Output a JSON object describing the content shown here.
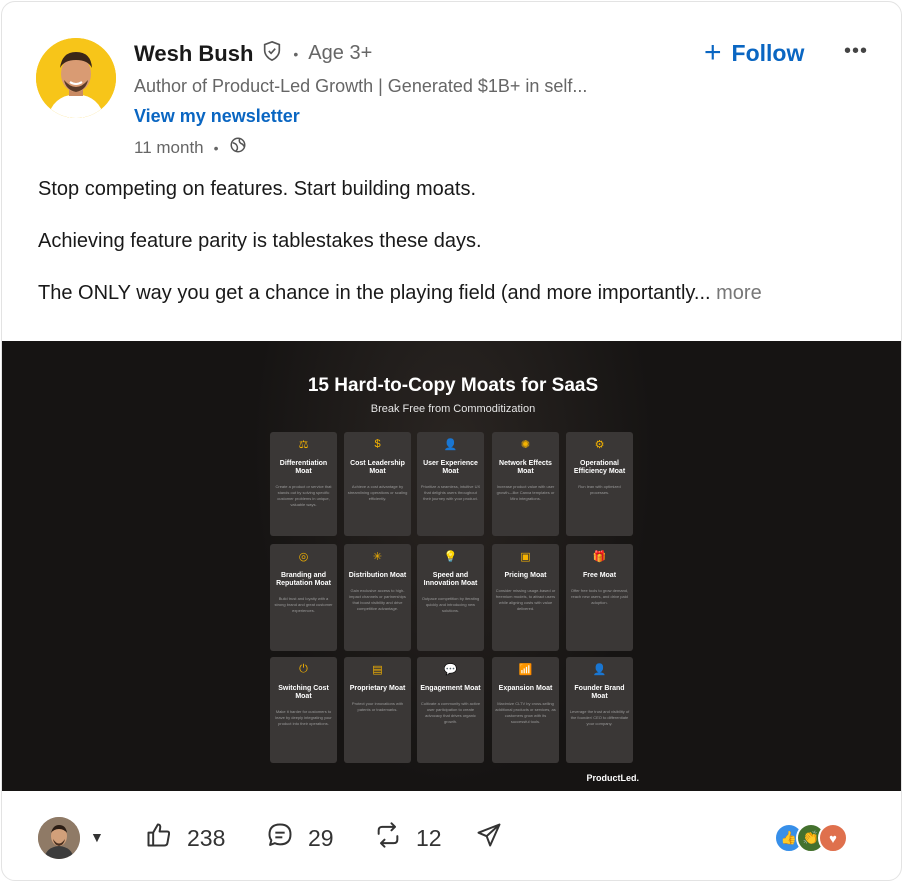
{
  "author": {
    "name": "Wesh Bush",
    "age": "Age 3+",
    "headline": "Author of Product-Led Growth | Generated $1B+ in self...",
    "newsletter": "View my newsletter",
    "time": "11 month"
  },
  "follow_label": "Follow",
  "post": {
    "line1": "Stop competing on features. Start building moats.",
    "line2": "Achieving feature parity is tablestakes these days.",
    "line3": "The ONLY way you get a chance in the playing field (and more importantly...",
    "more": " more"
  },
  "infographic": {
    "title": "15 Hard-to-Copy Moats for SaaS",
    "subtitle": "Break Free from Commoditization",
    "brand": "ProductLed.",
    "tiles": [
      {
        "icon": "⚖",
        "title": "Differentiation Moat",
        "desc": "Create a product or service that stands out by solving specific customer problems in unique, valuable ways."
      },
      {
        "icon": "$",
        "title": "Cost Leadership Moat",
        "desc": "Achieve a cost advantage by streamlining operations or scaling efficiently."
      },
      {
        "icon": "👤",
        "title": "User Experience Moat",
        "desc": "Prioritize a seamless, intuitive UX that delights users throughout their journey with your product."
      },
      {
        "icon": "✺",
        "title": "Network Effects Moat",
        "desc": "Increase product value with user growth—like Canva templates or Miro integrations."
      },
      {
        "icon": "⚙",
        "title": "Operational Efficiency Moat",
        "desc": "Run lean with optimized processes."
      },
      {
        "icon": "◎",
        "title": "Branding and Reputation Moat",
        "desc": "Build trust and loyalty with a strong brand and great customer experiences."
      },
      {
        "icon": "✳",
        "title": "Distribution Moat",
        "desc": "Gain exclusive access to high-impact channels or partnerships that boost visibility and drive competitive advantage."
      },
      {
        "icon": "💡",
        "title": "Speed and Innovation Moat",
        "desc": "Outpace competition by iterating quickly and introducing new solutions."
      },
      {
        "icon": "▣",
        "title": "Pricing Moat",
        "desc": "Consider missing usage-based or freemium models, to attract users while aligning costs with value delivered."
      },
      {
        "icon": "🎁",
        "title": "Free Moat",
        "desc": "Offer free tools to grow demand, reach new users, and drive paid adoption."
      },
      {
        "icon": "⏻",
        "title": "Switching Cost Moat",
        "desc": "Make it harder for customers to leave by deeply integrating your product into their operations."
      },
      {
        "icon": "▤",
        "title": "Proprietary Moat",
        "desc": "Protect your innovations with patents or trademarks."
      },
      {
        "icon": "💬",
        "title": "Engagement Moat",
        "desc": "Cultivate a community with active user participation to create advocacy that drives organic growth."
      },
      {
        "icon": "📶",
        "title": "Expansion Moat",
        "desc": "Maximize CLTV by cross-selling additional products or services, as customers grow with its successful tools."
      },
      {
        "icon": "👤",
        "title": "Founder Brand Moat",
        "desc": "Leverage the trust and visibility of the founder/ CEO to differentiate your company."
      }
    ]
  },
  "actions": {
    "likes": "238",
    "comments": "29",
    "reposts": "12"
  },
  "colors": {
    "accent": "#0a66c2",
    "tile_icon": "#f5b301"
  }
}
